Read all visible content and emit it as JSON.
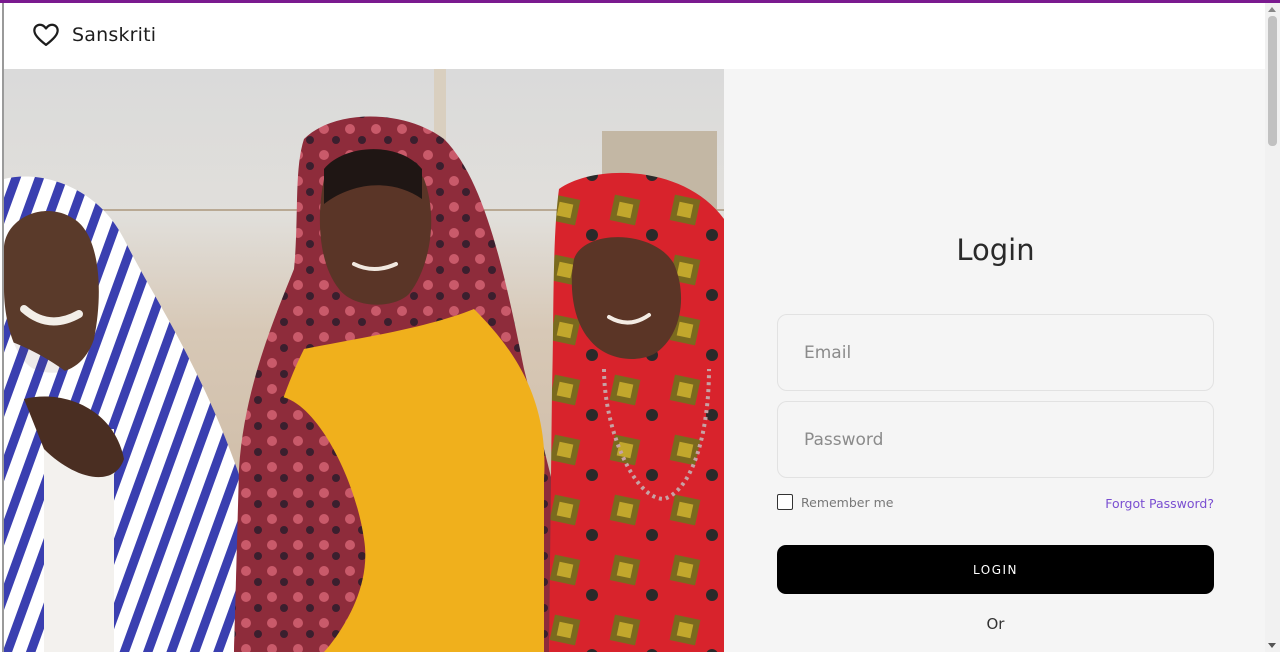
{
  "brand": {
    "name": "Sanskriti",
    "icon": "heart-icon"
  },
  "hero": {
    "image": "photo-three-women-in-colorful-headscarves"
  },
  "login": {
    "title": "Login",
    "email_placeholder": "Email",
    "password_placeholder": "Password",
    "remember_label": "Remember me",
    "forgot_label": "Forgot Password?",
    "button_label": "LOGIN",
    "or_text": "Or"
  },
  "colors": {
    "accent_bar": "#7a1a8f",
    "link": "#7a4fd1",
    "button": "#000000",
    "panel_bg": "#f5f5f5"
  }
}
